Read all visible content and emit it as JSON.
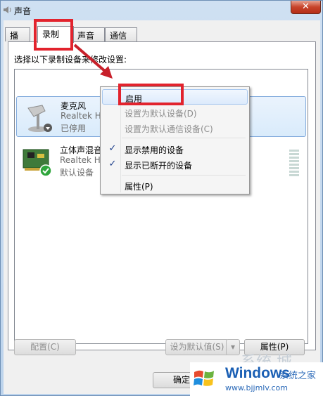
{
  "window": {
    "title": "声音",
    "close_glyph": "✕"
  },
  "tabs": [
    "播放",
    "录制",
    "声音",
    "通信"
  ],
  "instruction": "选择以下录制设备来修改设置:",
  "devices": [
    {
      "name": "麦克风",
      "driver": "Realtek H",
      "status": "已停用",
      "icon": "microphone-icon"
    },
    {
      "name": "立体声混音",
      "driver": "Realtek H",
      "status": "默认设备",
      "icon": "sound-card-icon"
    }
  ],
  "context_menu": {
    "items": [
      {
        "label": "启用",
        "disabled": false,
        "checked": false
      },
      {
        "label": "设置为默认设备(D)",
        "disabled": true,
        "checked": false
      },
      {
        "label": "设置为默认通信设备(C)",
        "disabled": true,
        "checked": false
      },
      {
        "label": "显示禁用的设备",
        "disabled": false,
        "checked": true
      },
      {
        "label": "显示已断开的设备",
        "disabled": false,
        "checked": true
      },
      {
        "label": "属性(P)",
        "disabled": false,
        "checked": false
      }
    ],
    "check_glyph": "✓"
  },
  "buttons": {
    "configure": "配置(C)",
    "set_default": "设为默认值(S)",
    "properties": "属性(P)",
    "ok": "确定"
  },
  "watermark": {
    "title": "Windows",
    "subtitle": "系统之家",
    "url": "www.bjjmlv.com",
    "faint": "系统 城"
  },
  "colors": {
    "annotation": "#e2232d",
    "selection": "#d9ebfb",
    "accent": "#1a5fb4"
  }
}
